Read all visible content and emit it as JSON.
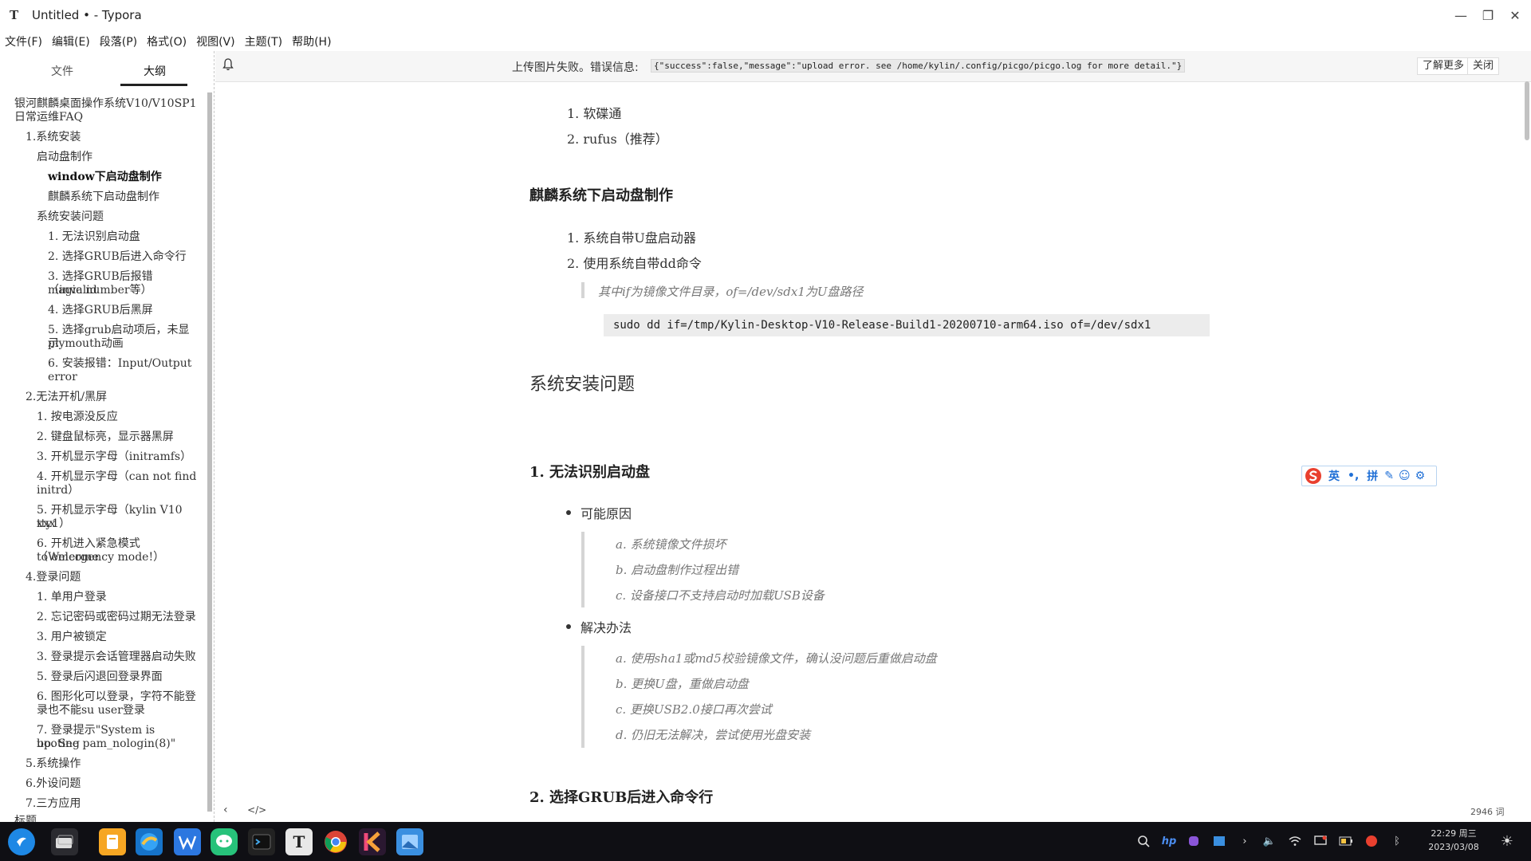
{
  "window": {
    "title": "Untitled • - Typora",
    "app_glyph": "T"
  },
  "menu": [
    "文件(F)",
    "编辑(E)",
    "段落(P)",
    "格式(O)",
    "视图(V)",
    "主题(T)",
    "帮助(H)"
  ],
  "sidebar": {
    "tabs": [
      "文件",
      "大纲"
    ],
    "active_tab": "大纲",
    "outline": [
      "银河麒麟桌面操作系统V10/V10SP1",
      "日常运维FAQ",
      "1.系统安装",
      "启动盘制作",
      "window下启动盘制作",
      "麒麟系统下启动盘制作",
      "系统安装问题",
      "1. 无法识别启动盘",
      "2. 选择GRUB后进入命令行",
      "3. 选择GRUB后报错（invalid",
      "magic number等）",
      "4. 选择GRUB后黑屏",
      "5. 选择grub启动项后，未显示",
      "plymouth动画",
      "6. 安装报错：Input/Output",
      "error",
      "2.无法开机/黑屏",
      "1. 按电源没反应",
      "2. 键盘鼠标亮，显示器黑屏",
      "3. 开机显示字母（initramfs）",
      "4. 开机显示字母（can not find",
      "initrd）",
      "5. 开机显示字母（kylin V10 xxx",
      "tty1）",
      "6. 开机进入紧急模式（Welcome",
      "to emergency mode!）",
      "4.登录问题",
      "1. 单用户登录",
      "2. 忘记密码或密码过期无法登录",
      "3. 用户被锁定",
      "3. 登录提示会话管理器启动失败",
      "5. 登录后闪退回登录界面",
      "6. 图形化可以登录，字符不能登",
      "录也不能su user登录",
      "7. 登录提示\"System is booting",
      "up. See pam_nologin(8)\"",
      "5.系统操作",
      "6.外设问题",
      "7.三方应用",
      "标题"
    ]
  },
  "notification": {
    "message": "上传图片失败。错误信息:",
    "detail": "{\"success\":false,\"message\":\"upload error. see /home/kylin/.config/picgo/picgo.log for more detail.\"}",
    "learn_more": "了解更多",
    "close": "关闭"
  },
  "document": {
    "list1": [
      "软碟通",
      "rufus（推荐）"
    ],
    "h3_kylin": "麒麟系统下启动盘制作",
    "list2": [
      "系统自带U盘启动器",
      "使用系统自带dd命令"
    ],
    "quote1": "其中if为镜像文件目录，of=/dev/sdx1为U盘路径",
    "code1": "sudo dd if=/tmp/Kylin-Desktop-V10-Release-Build1-20200710-arm64.iso of=/dev/sdx1",
    "h2_install": "系统安装问题",
    "h3_usb": "1. 无法识别启动盘",
    "bullet_cause": "可能原因",
    "causes": [
      "a. 系统镜像文件损坏",
      "b. 启动盘制作过程出错",
      "c. 设备接口不支持启动时加载USB设备"
    ],
    "bullet_fix": "解决办法",
    "fixes": [
      "a. 使用sha1或md5校验镜像文件，确认没问题后重做启动盘",
      "b. 更换U盘，重做启动盘",
      "c. 更换USB2.0接口再次尝试",
      "d. 仍旧无法解决，尝试使用光盘安装"
    ],
    "h3_grub": "2. 选择GRUB后进入命令行"
  },
  "ime": {
    "lang": "英",
    "mode": "拼"
  },
  "status": {
    "word_count": "2946 词",
    "back": "‹",
    "source": "</>"
  },
  "taskbar": {
    "clock_time": "22:29 周三",
    "clock_date": "2023/03/08"
  }
}
